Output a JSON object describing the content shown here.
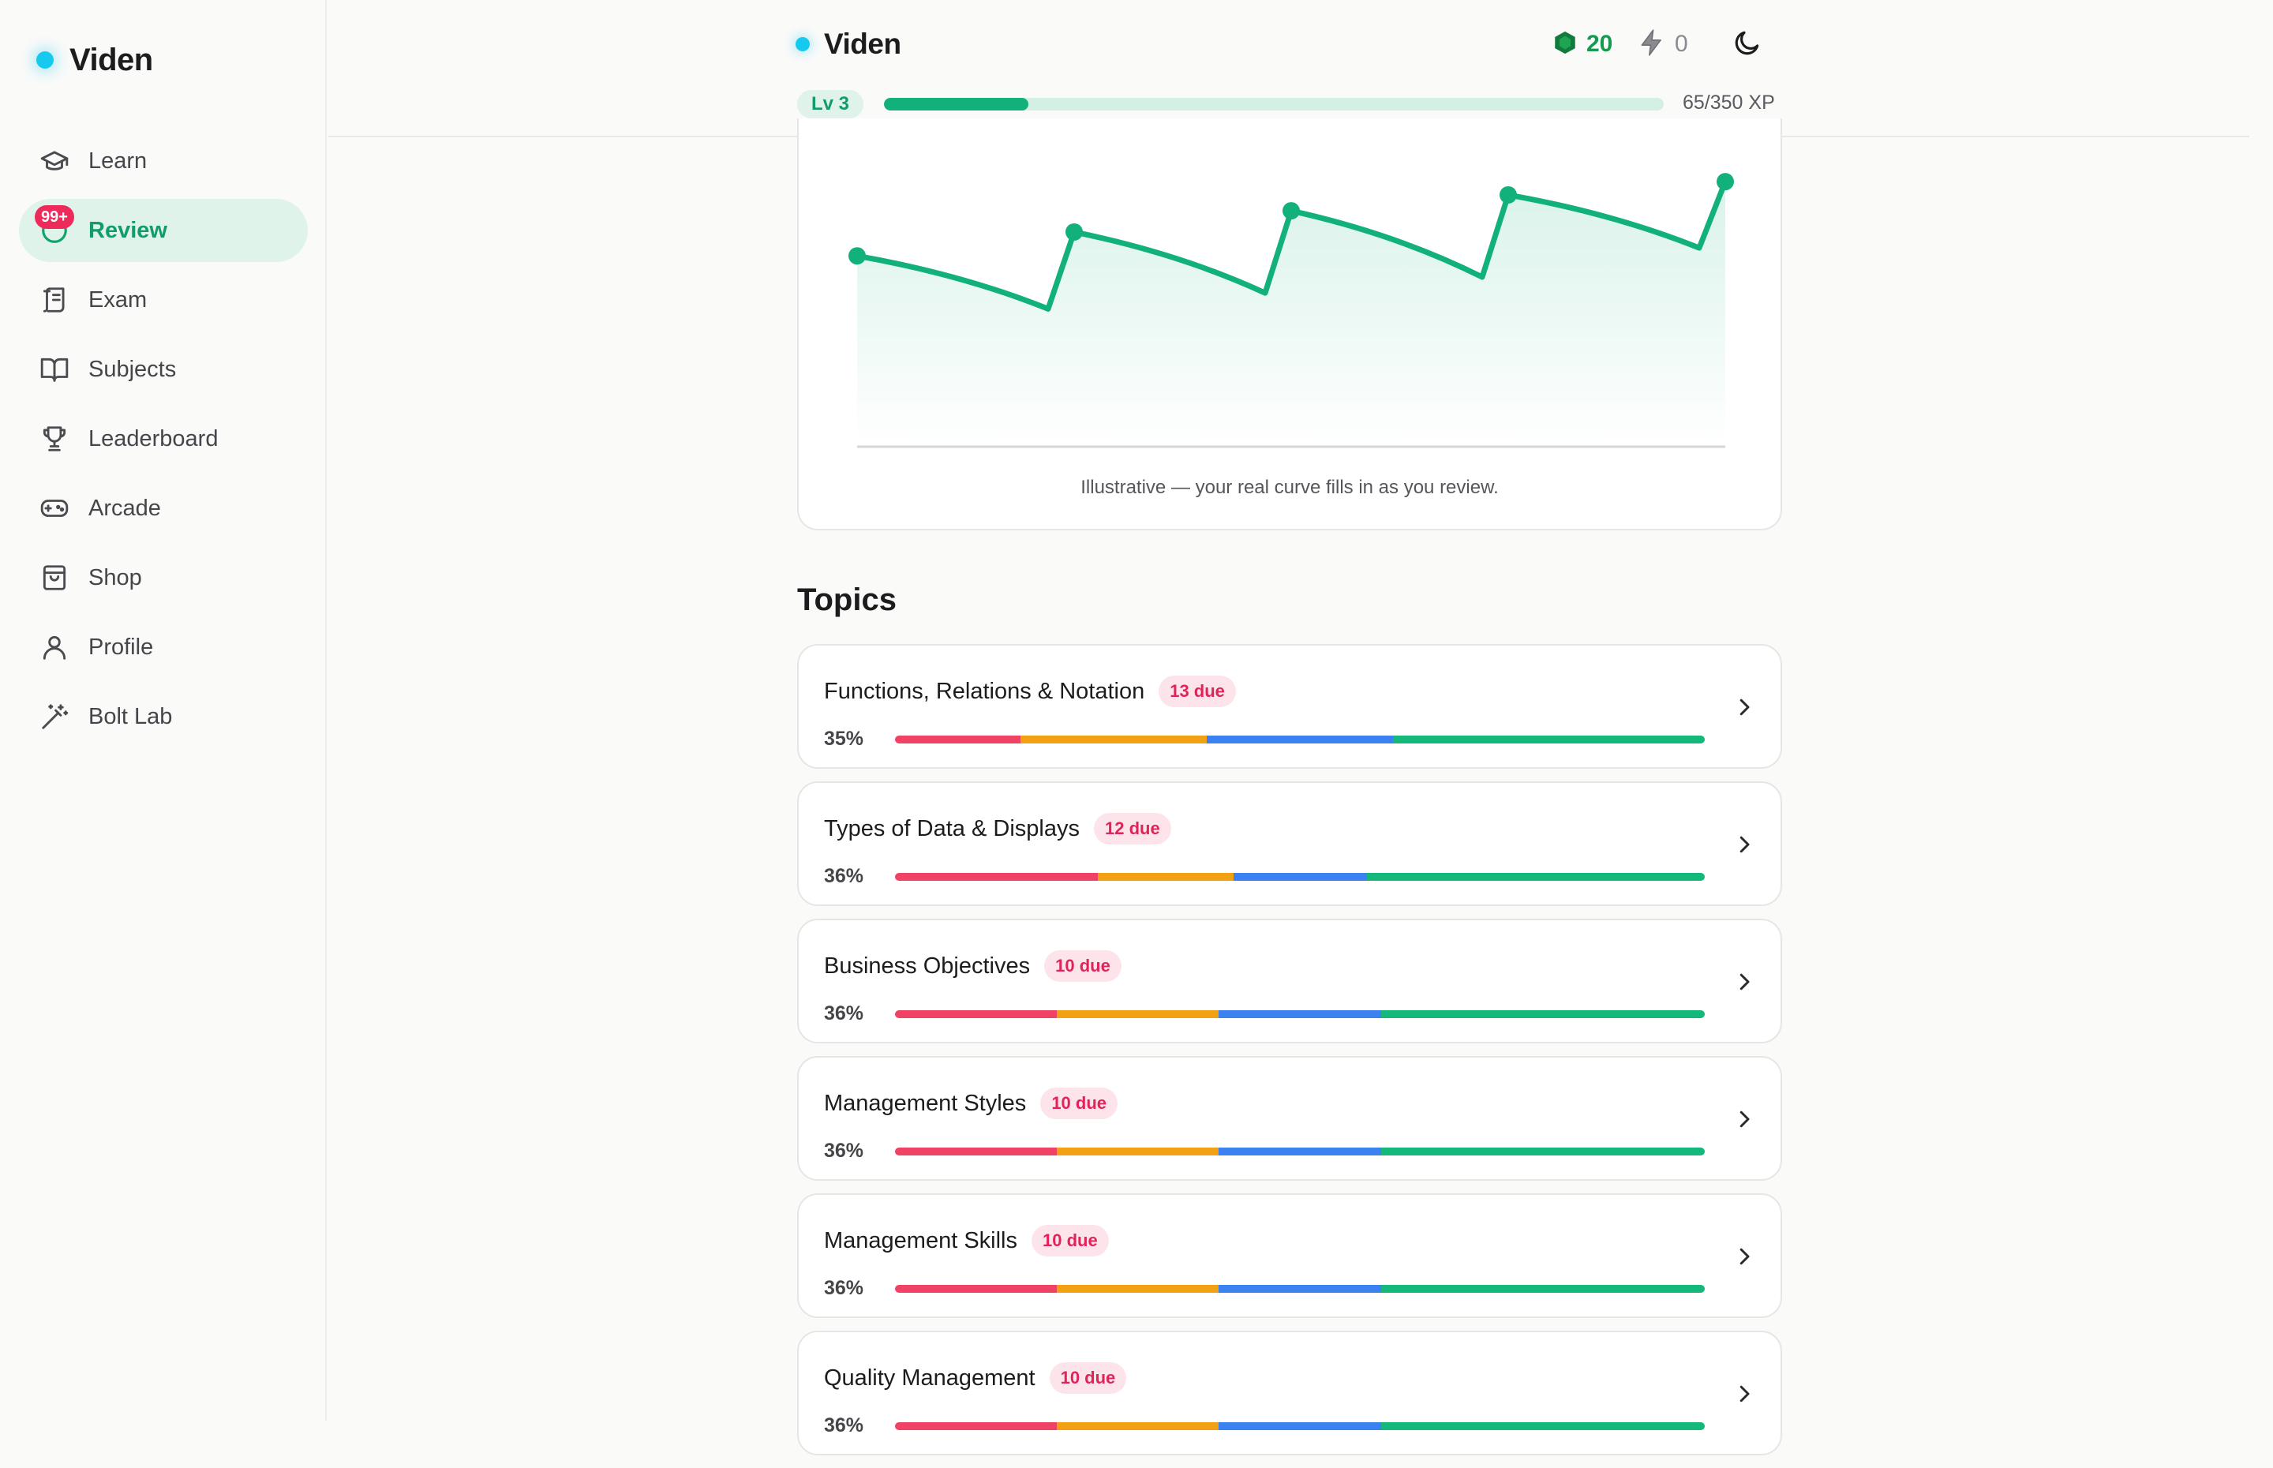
{
  "app": {
    "name": "Viden"
  },
  "colors": {
    "accent": "#12b07a",
    "brand_dot": "#16c9ee",
    "badge": "#ee2a5a",
    "due_text": "#e0245a",
    "seg_red": "#ef4265",
    "seg_orange": "#f2a114",
    "seg_blue": "#3b82f0",
    "seg_green": "#13b87a"
  },
  "sidebar": {
    "items": [
      {
        "label": "Learn",
        "icon": "graduation-cap-icon"
      },
      {
        "label": "Review",
        "icon": "review-icon",
        "badge": "99+",
        "active": true
      },
      {
        "label": "Exam",
        "icon": "scroll-icon"
      },
      {
        "label": "Subjects",
        "icon": "book-icon"
      },
      {
        "label": "Leaderboard",
        "icon": "trophy-icon"
      },
      {
        "label": "Arcade",
        "icon": "gamepad-icon"
      },
      {
        "label": "Shop",
        "icon": "shopping-bag-icon"
      },
      {
        "label": "Profile",
        "icon": "user-icon"
      },
      {
        "label": "Bolt Lab",
        "icon": "magic-wand-icon"
      }
    ]
  },
  "header": {
    "gems": "20",
    "bolts": "0",
    "level": "Lv 3",
    "xp_text": "65/350 XP",
    "xp_current": 65,
    "xp_max": 350
  },
  "chart": {
    "caption": "Illustrative — your real curve fills in as you review."
  },
  "chart_data": {
    "type": "line",
    "title": "",
    "xlabel": "",
    "ylabel": "",
    "series": [
      {
        "values": [
          0.72,
          0.52,
          0.81,
          0.58,
          0.89,
          0.64,
          0.95,
          0.75,
          1.0
        ]
      }
    ],
    "x": [
      0,
      0.22,
      0.25,
      0.47,
      0.5,
      0.72,
      0.75,
      0.97,
      1.0
    ],
    "review_points": [
      0,
      2,
      4,
      6,
      8
    ],
    "ylim": [
      0,
      1.06
    ],
    "grid": false
  },
  "topics_title": "Topics",
  "topics": [
    {
      "name": "Functions, Relations & Notation",
      "due": "13 due",
      "percent": "35%",
      "segments": [
        0.155,
        0.23,
        0.23,
        0.385
      ]
    },
    {
      "name": "Types of Data & Displays",
      "due": "12 due",
      "percent": "36%",
      "segments": [
        0.25,
        0.168,
        0.165,
        0.417
      ]
    },
    {
      "name": "Business Objectives",
      "due": "10 due",
      "percent": "36%",
      "segments": [
        0.2,
        0.2,
        0.2,
        0.4
      ]
    },
    {
      "name": "Management Styles",
      "due": "10 due",
      "percent": "36%",
      "segments": [
        0.2,
        0.2,
        0.2,
        0.4
      ]
    },
    {
      "name": "Management Skills",
      "due": "10 due",
      "percent": "36%",
      "segments": [
        0.2,
        0.2,
        0.2,
        0.4
      ]
    },
    {
      "name": "Quality Management",
      "due": "10 due",
      "percent": "36%",
      "segments": [
        0.2,
        0.2,
        0.2,
        0.4
      ]
    }
  ]
}
